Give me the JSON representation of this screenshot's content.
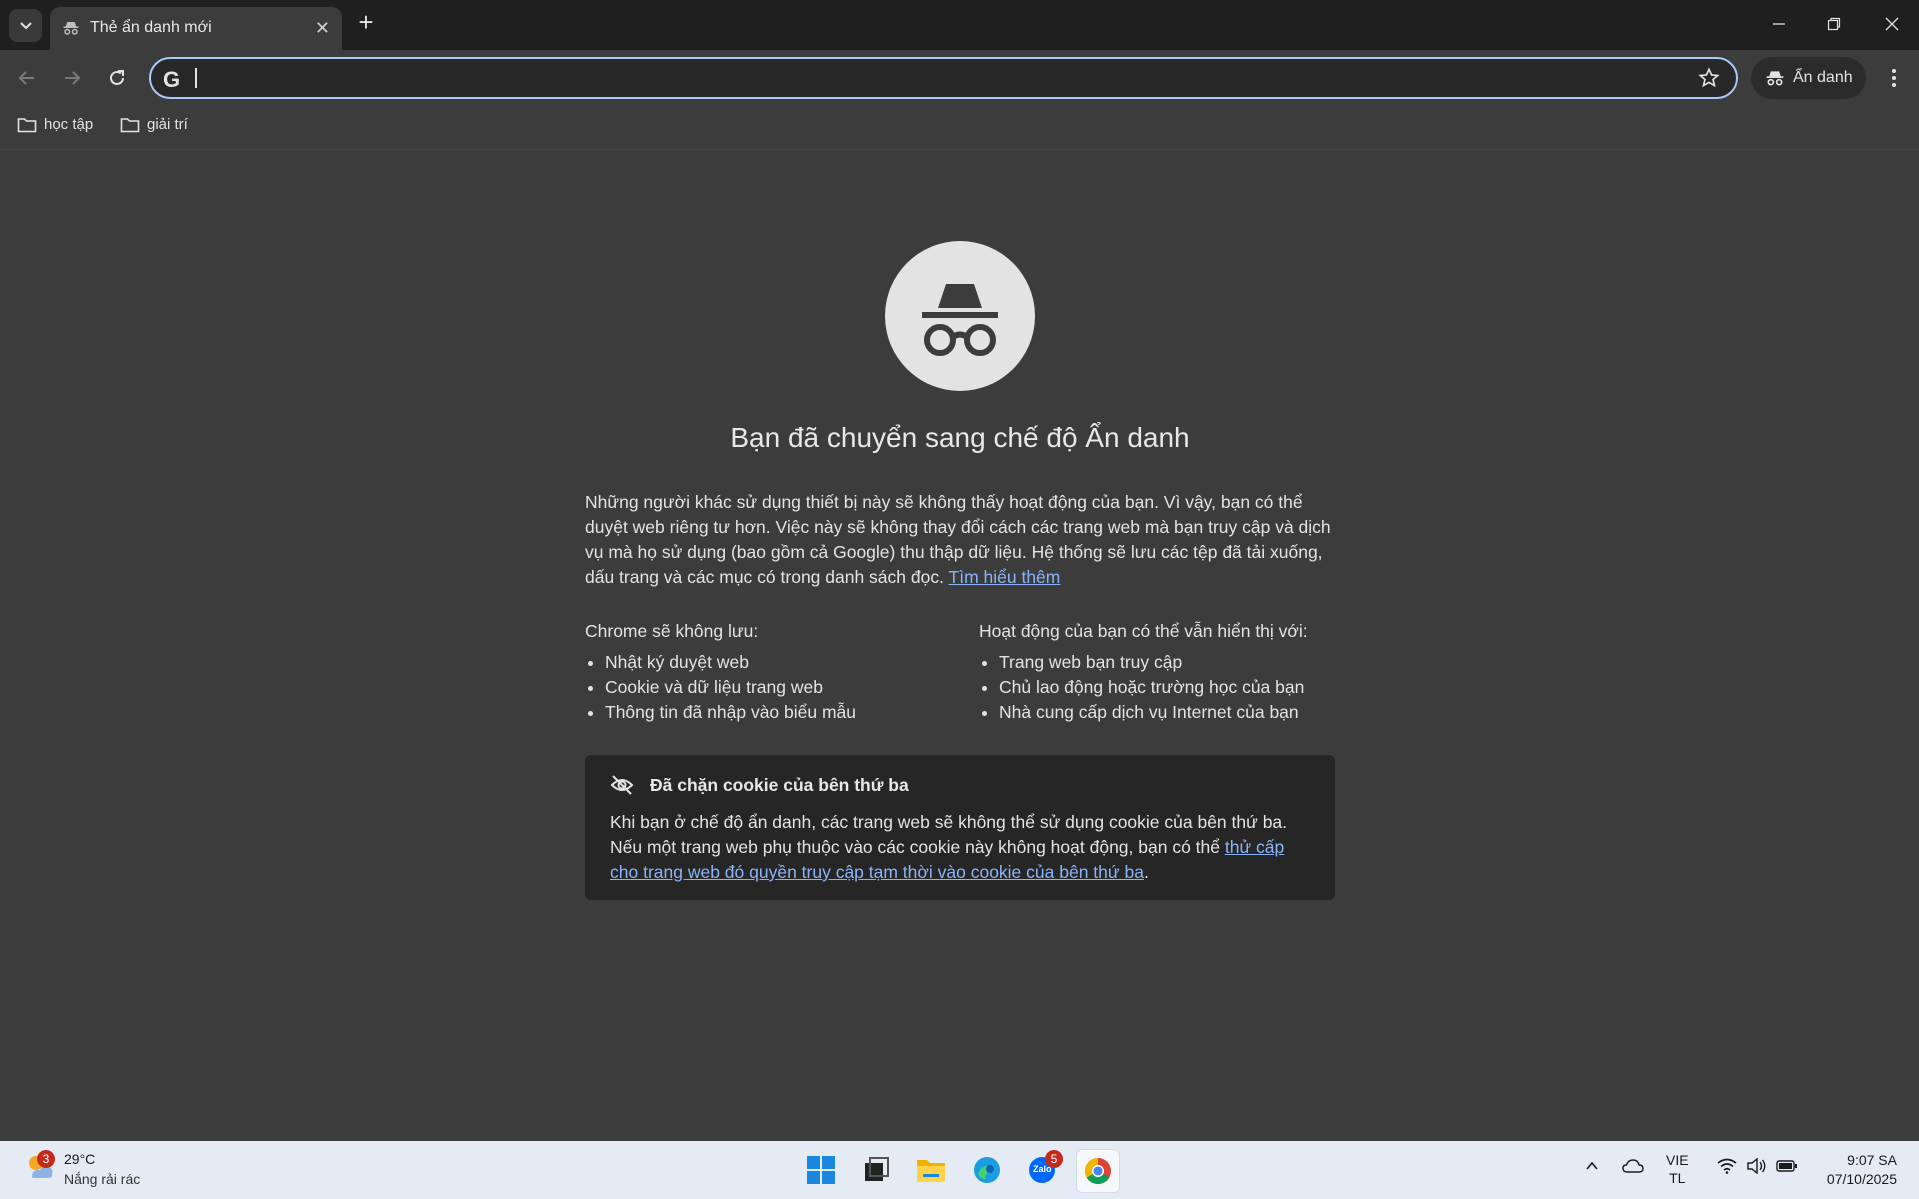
{
  "tab": {
    "title": "Thẻ ẩn danh mới",
    "close": "✕",
    "new_tab": "+"
  },
  "omnibox": {
    "placeholder": "",
    "value": ""
  },
  "incognito_chip": {
    "label": "Ẩn danh"
  },
  "bookmarks": [
    {
      "label": "học tập"
    },
    {
      "label": "giải trí"
    }
  ],
  "page": {
    "heading": "Bạn đã chuyển sang chế độ Ẩn danh",
    "intro": "Những người khác sử dụng thiết bị này sẽ không thấy hoạt động của bạn. Vì vậy, bạn có thể duyệt web riêng tư hơn. Việc này sẽ không thay đổi cách các trang web mà bạn truy cập và dịch vụ mà họ sử dụng (bao gồm cả Google) thu thập dữ liệu. Hệ thống sẽ lưu các tệp đã tải xuống, dấu trang và các mục có trong danh sách đọc.",
    "learn_more": "Tìm hiểu thêm",
    "left_col": {
      "title": "Chrome sẽ không lưu:",
      "items": [
        "Nhật ký duyệt web",
        "Cookie và dữ liệu trang web",
        "Thông tin đã nhập vào biểu mẫu"
      ]
    },
    "right_col": {
      "title": "Hoạt động của bạn có thể vẫn hiển thị với:",
      "items": [
        "Trang web bạn truy cập",
        "Chủ lao động hoặc trường học của bạn",
        "Nhà cung cấp dịch vụ Internet của bạn"
      ]
    },
    "cookie": {
      "title": "Đã chặn cookie của bên thứ ba",
      "text": "Khi bạn ở chế độ ẩn danh, các trang web sẽ không thể sử dụng cookie của bên thứ ba. Nếu một trang web phụ thuộc vào các cookie này không hoạt động, bạn có thể ",
      "link": "thử cấp cho trang web đó quyền truy cập tạm thời vào cookie của bên thứ ba",
      "end": "."
    }
  },
  "taskbar": {
    "weather_badge": "3",
    "temp": "29°C",
    "condition": "Nắng rải rác",
    "zalo_badge": "5",
    "zalo_text": "Zalo",
    "lang_1": "VIE",
    "lang_2": "TL",
    "time": "9:07 SA",
    "date": "07/10/2025"
  },
  "colors": {
    "accent": "#a8c7fa",
    "link": "#8ab4f8",
    "background": "#3c3c3c",
    "titlebar": "#1f1f1f",
    "taskbar": "#e4ebf4"
  },
  "icons": [
    "tab-search-icon",
    "incognito-icon",
    "close-icon",
    "plus-icon",
    "minimize-icon",
    "restore-icon",
    "back-icon",
    "forward-icon",
    "reload-icon",
    "google-icon",
    "star-icon",
    "menu-icon",
    "folder-icon",
    "eye-off-icon",
    "weather-icon",
    "windows-start-icon",
    "task-view-icon",
    "file-explorer-icon",
    "edge-icon",
    "zalo-icon",
    "chrome-icon",
    "chevron-up-icon",
    "cloud-icon",
    "wifi-icon",
    "volume-icon",
    "battery-icon"
  ]
}
